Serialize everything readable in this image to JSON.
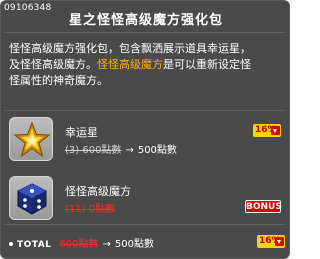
{
  "item_id": "09106348",
  "title": "星之怪怪高级魔方强化包",
  "description": {
    "line1": "怪怪高级魔方强化包，包含飘洒展示道具幸运星，",
    "line2_prefix": "及怪怪高级魔方。",
    "line2_highlight": "怪怪高级魔方",
    "line2_suffix": "是可以重新设定怪",
    "line3": "怪属性的神奇魔方。"
  },
  "items": [
    {
      "name": "幸运星",
      "old_price": "(3) 600點數",
      "new_price": "500點數",
      "badge": "16",
      "icon": "lucky-star-icon"
    },
    {
      "name": "怪怪高级魔方",
      "old_price": "(11) 0點數",
      "badge": "BONUS",
      "icon": "monster-cube-icon"
    }
  ],
  "total": {
    "label": "TOTAL",
    "old_price": "600點數",
    "new_price": "500點數",
    "badge": "16"
  },
  "colors": {
    "panel_bg": "#4a4a4a",
    "highlight": "#ffb400",
    "discount_badge": "#ffd400",
    "bonus_badge": "#d40000",
    "strike_red": "#ff2a2a"
  }
}
